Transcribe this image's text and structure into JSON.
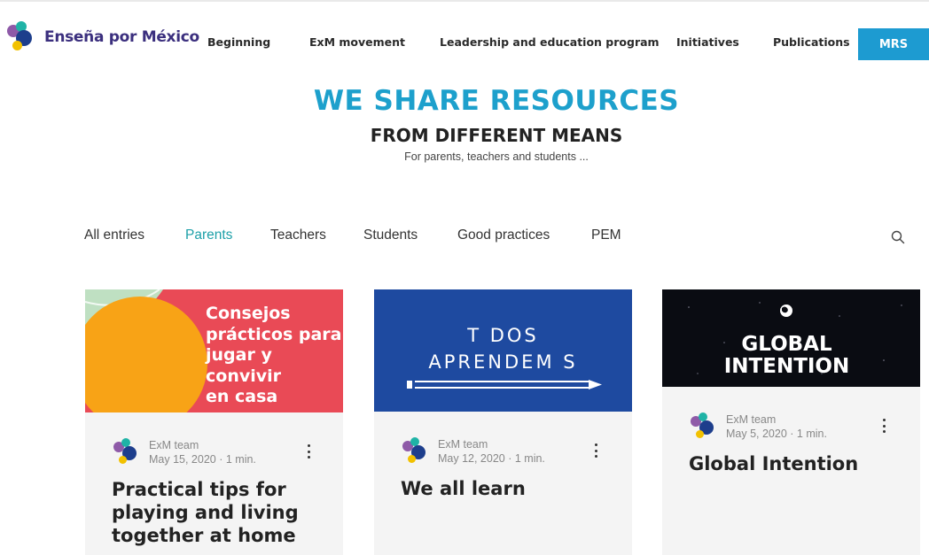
{
  "brand": {
    "name": "Enseña por México"
  },
  "nav": {
    "items": [
      "Beginning",
      "ExM movement",
      "Leadership and education program",
      "Initiatives",
      "Publications"
    ],
    "cta": "MRS"
  },
  "hero": {
    "title": "WE SHARE RESOURCES",
    "subtitle": "FROM DIFFERENT MEANS",
    "description": "For parents, teachers and students ..."
  },
  "filters": {
    "tabs": [
      "All entries",
      "Parents",
      "Teachers",
      "Students",
      "Good practices",
      "PEM"
    ],
    "active": "Parents",
    "search_icon": "search-icon"
  },
  "colors": {
    "accent": "#1da0cc",
    "active_tab": "#1da0a8",
    "cta_bg": "#1d9bd1",
    "brand_text": "#3b2f7e",
    "card_bg": "#f4f4f4"
  },
  "posts": [
    {
      "image_text": [
        "Consejos",
        "prácticos para",
        "jugar y convivir",
        "en casa"
      ],
      "author": "ExM team",
      "date": "May 15, 2020",
      "read_time": "1 min.",
      "title": "Practical tips for playing and living together at home"
    },
    {
      "image_text": [
        "T DOS",
        "APRENDEM S"
      ],
      "author": "ExM team",
      "date": "May 12, 2020",
      "read_time": "1 min.",
      "title": "We all learn"
    },
    {
      "image_text": [
        "GLOBAL",
        "INTENTION"
      ],
      "author": "ExM team",
      "date": "May 5, 2020",
      "read_time": "1 min.",
      "title": "Global Intention"
    }
  ]
}
